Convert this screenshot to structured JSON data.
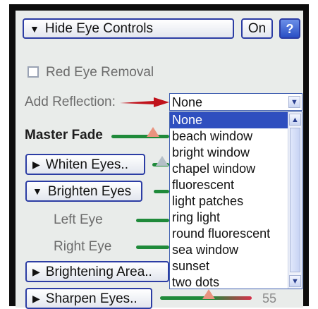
{
  "hide_eye_controls": {
    "label": "Hide Eye Controls",
    "toggle": "On",
    "help": "?"
  },
  "red_eye": {
    "label": "Red Eye Removal",
    "checked": false
  },
  "reflection": {
    "label": "Add Reflection:",
    "selected": "None",
    "options": [
      "None",
      "beach window",
      "bright window",
      "chapel window",
      "fluorescent",
      "light patches",
      "ring light",
      "round fluorescent",
      "sea window",
      "sunset",
      "two dots"
    ]
  },
  "master_fade": {
    "label": "Master Fade"
  },
  "whiten": {
    "label": "Whiten Eyes.."
  },
  "brighten": {
    "label": "Brighten Eyes",
    "left": "Left Eye",
    "right": "Right Eye"
  },
  "brightening_area": {
    "label": "Brightening Area.."
  },
  "sharpen": {
    "label": "Sharpen Eyes..",
    "value": "55"
  },
  "colors": {
    "accent": "#2f4fbf",
    "slider": "#1f8a3a",
    "arrow": "#c0121b"
  }
}
